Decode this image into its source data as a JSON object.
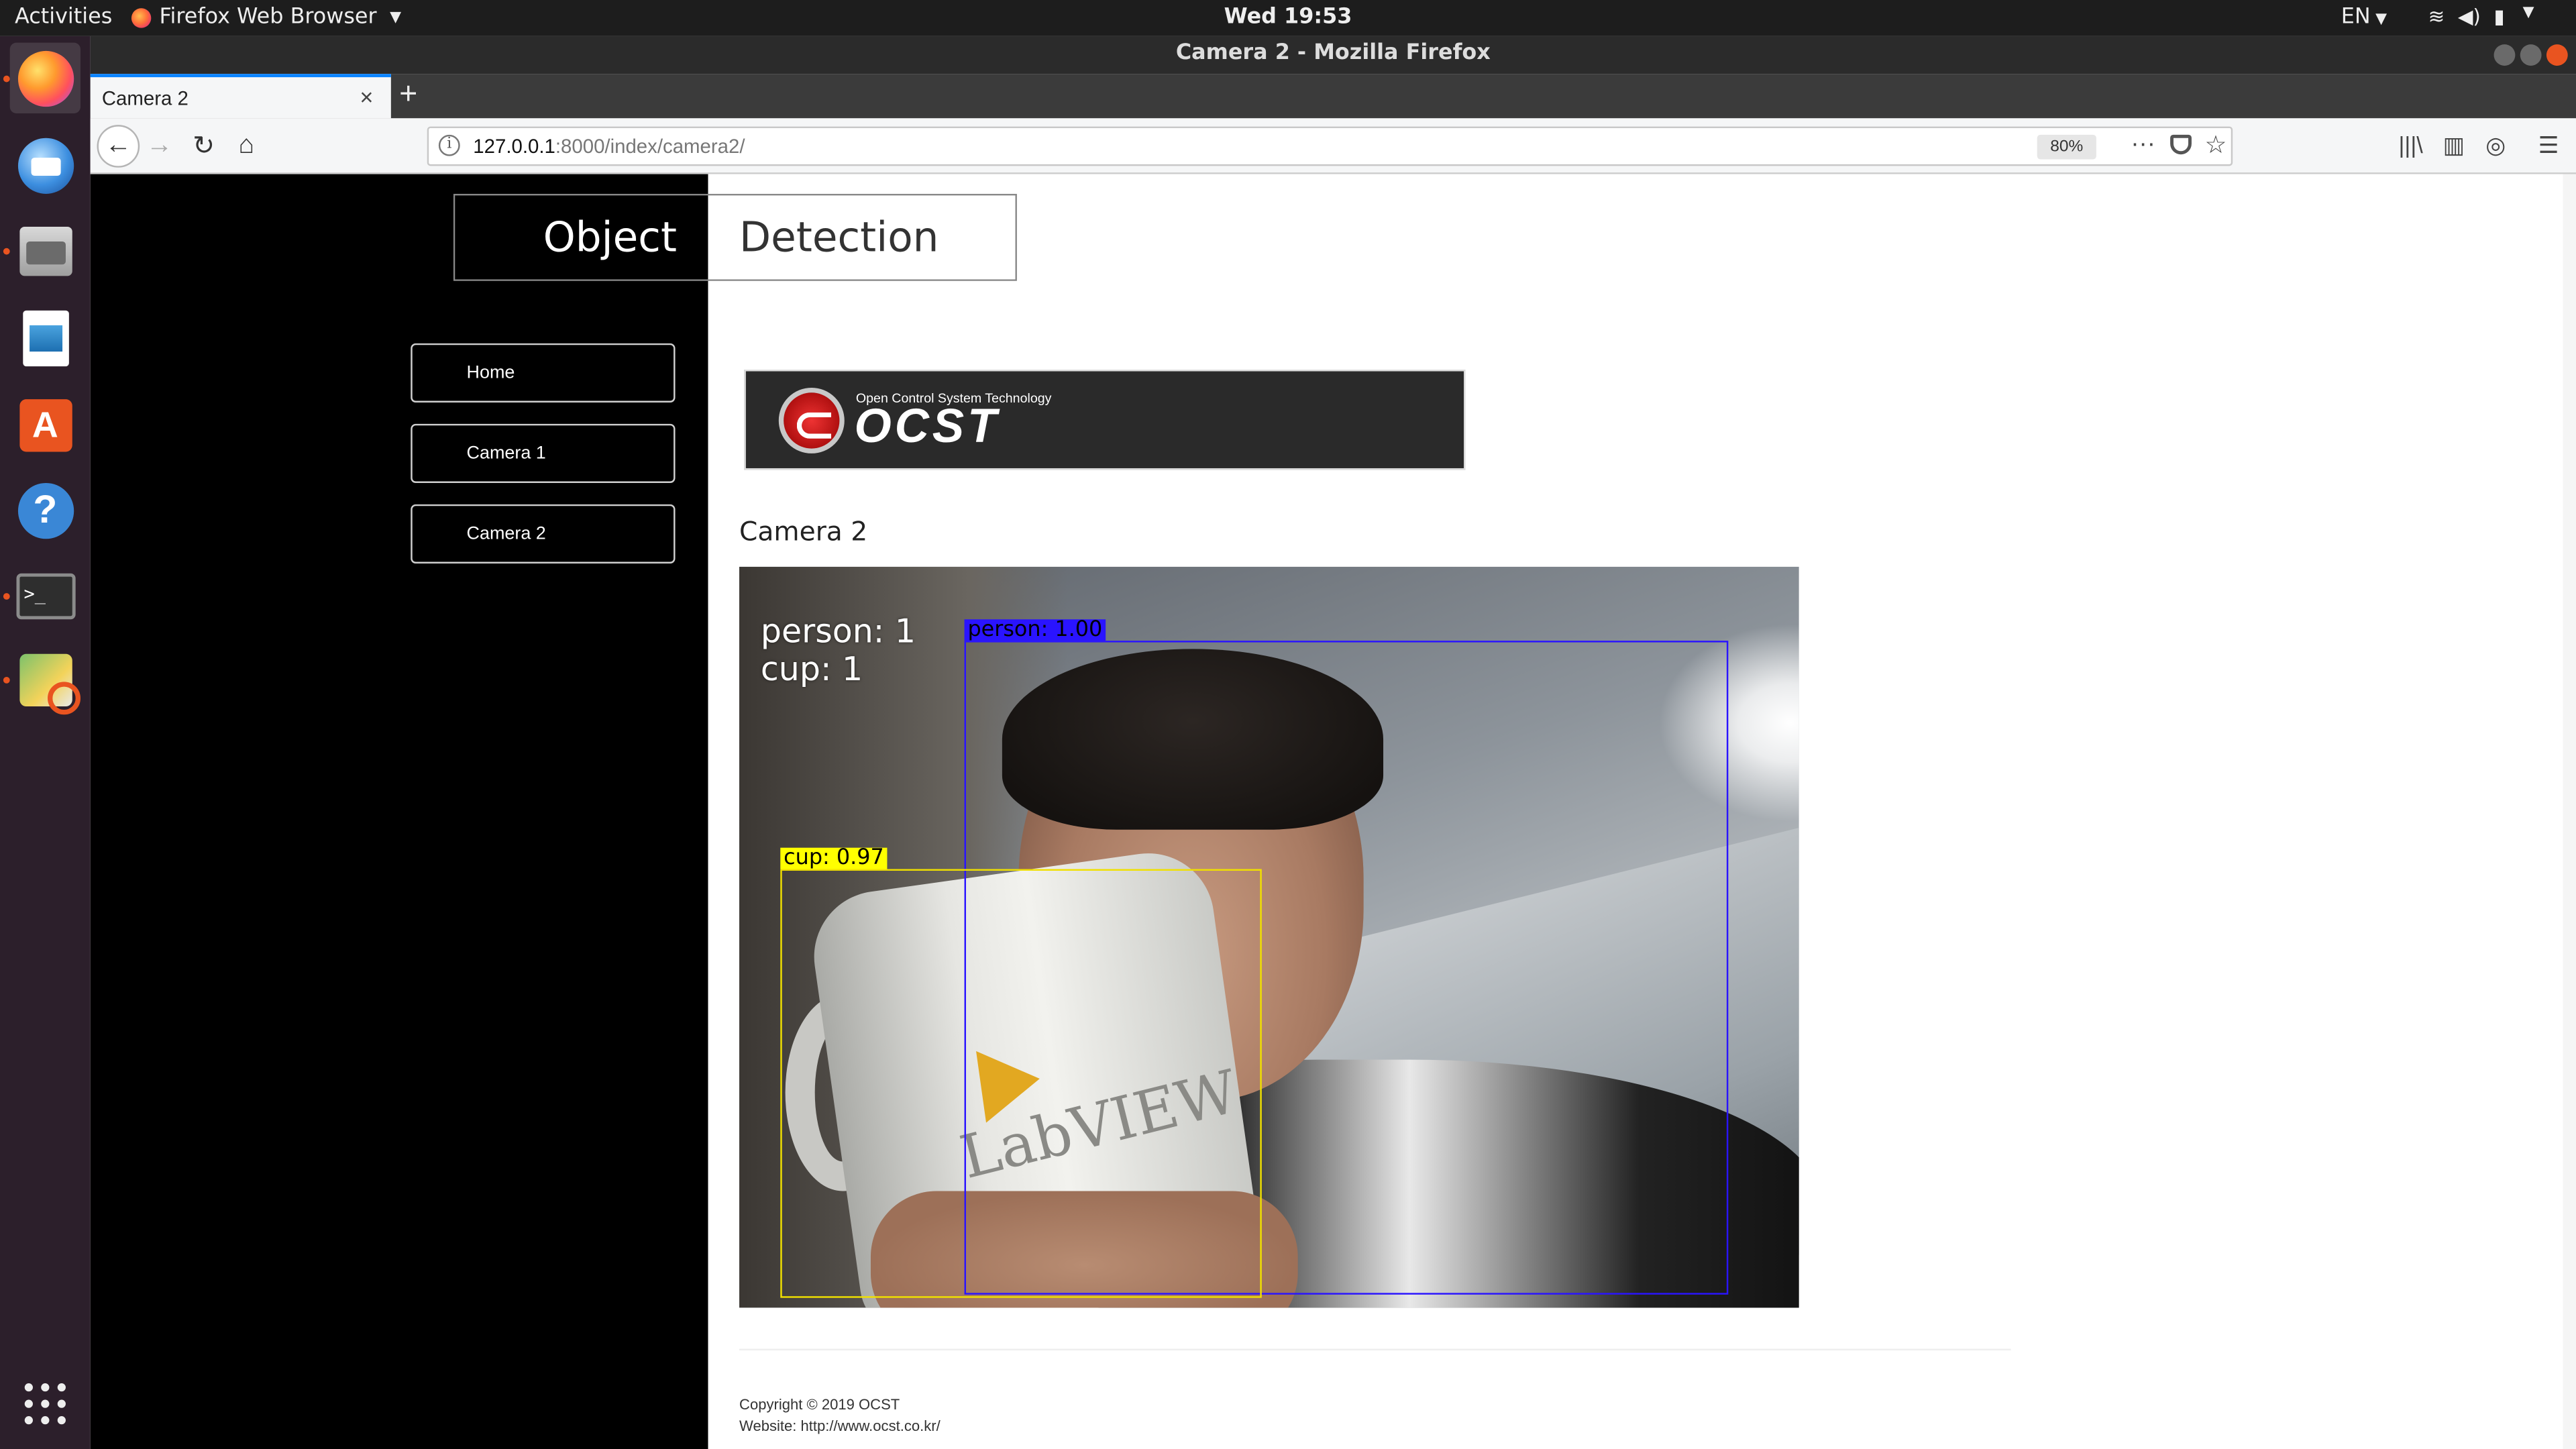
{
  "system_bar": {
    "activities": "Activities",
    "app_menu": "Firefox Web Browser",
    "clock": "Wed 19:53",
    "language": "EN"
  },
  "dock": {
    "items": [
      "firefox-icon",
      "thunderbird-icon",
      "files-icon",
      "impress-icon",
      "software-icon",
      "help-icon",
      "terminal-icon",
      "image-viewer-icon",
      "app-grid-icon"
    ],
    "terminal_glyph": ">_"
  },
  "window": {
    "title": "Camera 2 - Mozilla Firefox"
  },
  "browser": {
    "tab_title": "Camera 2",
    "url_host": "127.0.0.1",
    "url_rest": ":8000/index/camera2/",
    "zoom": "80%",
    "new_tab": "+",
    "tab_close": "×"
  },
  "site": {
    "brand_left": "Object",
    "brand_right": "Detection",
    "nav": [
      {
        "label": "Home"
      },
      {
        "label": "Camera 1"
      },
      {
        "label": "Camera 2"
      }
    ],
    "logo_tagline": "Open Control System Technology",
    "logo_name": "OCST",
    "page_heading": "Camera 2",
    "footer_copyright": "Copyright © 2019 OCST",
    "footer_website": "Website: http://www.ocst.co.kr/"
  },
  "camera": {
    "counts": [
      {
        "text": "person:  1"
      },
      {
        "text": "cup:  1"
      }
    ],
    "detections": [
      {
        "label": "person: 1.00",
        "color": "#2a14ff",
        "label_text_color": "#000000"
      },
      {
        "label": "cup: 0.97",
        "color": "#ffff00",
        "label_text_color": "#000000"
      }
    ],
    "mug_print": "LabVIEW",
    "box_color_person": "#2a14ff",
    "box_color_cup": "#f0e000"
  }
}
